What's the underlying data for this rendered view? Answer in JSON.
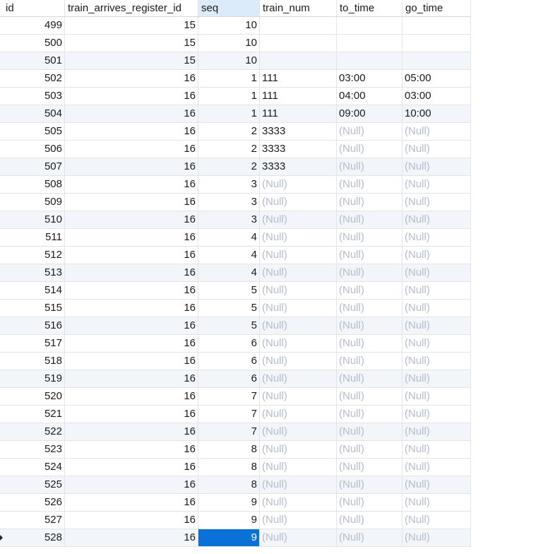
{
  "columns": {
    "id": "id",
    "train_arrives_register_id": "train_arrives_register_id",
    "seq": "seq",
    "train_num": "train_num",
    "to_time": "to_time",
    "go_time": "go_time"
  },
  "null_label": "(Null)",
  "selected_cell": {
    "id": "528",
    "column": "seq"
  },
  "rows": [
    {
      "id": "499",
      "reg": "15",
      "seq": "10",
      "train_num": "",
      "to_time": "",
      "go_time": ""
    },
    {
      "id": "500",
      "reg": "15",
      "seq": "10",
      "train_num": "",
      "to_time": "",
      "go_time": ""
    },
    {
      "id": "501",
      "reg": "15",
      "seq": "10",
      "train_num": "",
      "to_time": "",
      "go_time": ""
    },
    {
      "id": "502",
      "reg": "16",
      "seq": "1",
      "train_num": "111",
      "to_time": "03:00",
      "go_time": "05:00"
    },
    {
      "id": "503",
      "reg": "16",
      "seq": "1",
      "train_num": "111",
      "to_time": "04:00",
      "go_time": "03:00"
    },
    {
      "id": "504",
      "reg": "16",
      "seq": "1",
      "train_num": "111",
      "to_time": "09:00",
      "go_time": "10:00"
    },
    {
      "id": "505",
      "reg": "16",
      "seq": "2",
      "train_num": "3333",
      "to_time": null,
      "go_time": null
    },
    {
      "id": "506",
      "reg": "16",
      "seq": "2",
      "train_num": "3333",
      "to_time": null,
      "go_time": null
    },
    {
      "id": "507",
      "reg": "16",
      "seq": "2",
      "train_num": "3333",
      "to_time": null,
      "go_time": null
    },
    {
      "id": "508",
      "reg": "16",
      "seq": "3",
      "train_num": null,
      "to_time": null,
      "go_time": null
    },
    {
      "id": "509",
      "reg": "16",
      "seq": "3",
      "train_num": null,
      "to_time": null,
      "go_time": null
    },
    {
      "id": "510",
      "reg": "16",
      "seq": "3",
      "train_num": null,
      "to_time": null,
      "go_time": null
    },
    {
      "id": "511",
      "reg": "16",
      "seq": "4",
      "train_num": null,
      "to_time": null,
      "go_time": null
    },
    {
      "id": "512",
      "reg": "16",
      "seq": "4",
      "train_num": null,
      "to_time": null,
      "go_time": null
    },
    {
      "id": "513",
      "reg": "16",
      "seq": "4",
      "train_num": null,
      "to_time": null,
      "go_time": null
    },
    {
      "id": "514",
      "reg": "16",
      "seq": "5",
      "train_num": null,
      "to_time": null,
      "go_time": null
    },
    {
      "id": "515",
      "reg": "16",
      "seq": "5",
      "train_num": null,
      "to_time": null,
      "go_time": null
    },
    {
      "id": "516",
      "reg": "16",
      "seq": "5",
      "train_num": null,
      "to_time": null,
      "go_time": null
    },
    {
      "id": "517",
      "reg": "16",
      "seq": "6",
      "train_num": null,
      "to_time": null,
      "go_time": null
    },
    {
      "id": "518",
      "reg": "16",
      "seq": "6",
      "train_num": null,
      "to_time": null,
      "go_time": null
    },
    {
      "id": "519",
      "reg": "16",
      "seq": "6",
      "train_num": null,
      "to_time": null,
      "go_time": null
    },
    {
      "id": "520",
      "reg": "16",
      "seq": "7",
      "train_num": null,
      "to_time": null,
      "go_time": null
    },
    {
      "id": "521",
      "reg": "16",
      "seq": "7",
      "train_num": null,
      "to_time": null,
      "go_time": null
    },
    {
      "id": "522",
      "reg": "16",
      "seq": "7",
      "train_num": null,
      "to_time": null,
      "go_time": null
    },
    {
      "id": "523",
      "reg": "16",
      "seq": "8",
      "train_num": null,
      "to_time": null,
      "go_time": null
    },
    {
      "id": "524",
      "reg": "16",
      "seq": "8",
      "train_num": null,
      "to_time": null,
      "go_time": null
    },
    {
      "id": "525",
      "reg": "16",
      "seq": "8",
      "train_num": null,
      "to_time": null,
      "go_time": null
    },
    {
      "id": "526",
      "reg": "16",
      "seq": "9",
      "train_num": null,
      "to_time": null,
      "go_time": null
    },
    {
      "id": "527",
      "reg": "16",
      "seq": "9",
      "train_num": null,
      "to_time": null,
      "go_time": null
    },
    {
      "id": "528",
      "reg": "16",
      "seq": "9",
      "train_num": null,
      "to_time": null,
      "go_time": null
    }
  ]
}
